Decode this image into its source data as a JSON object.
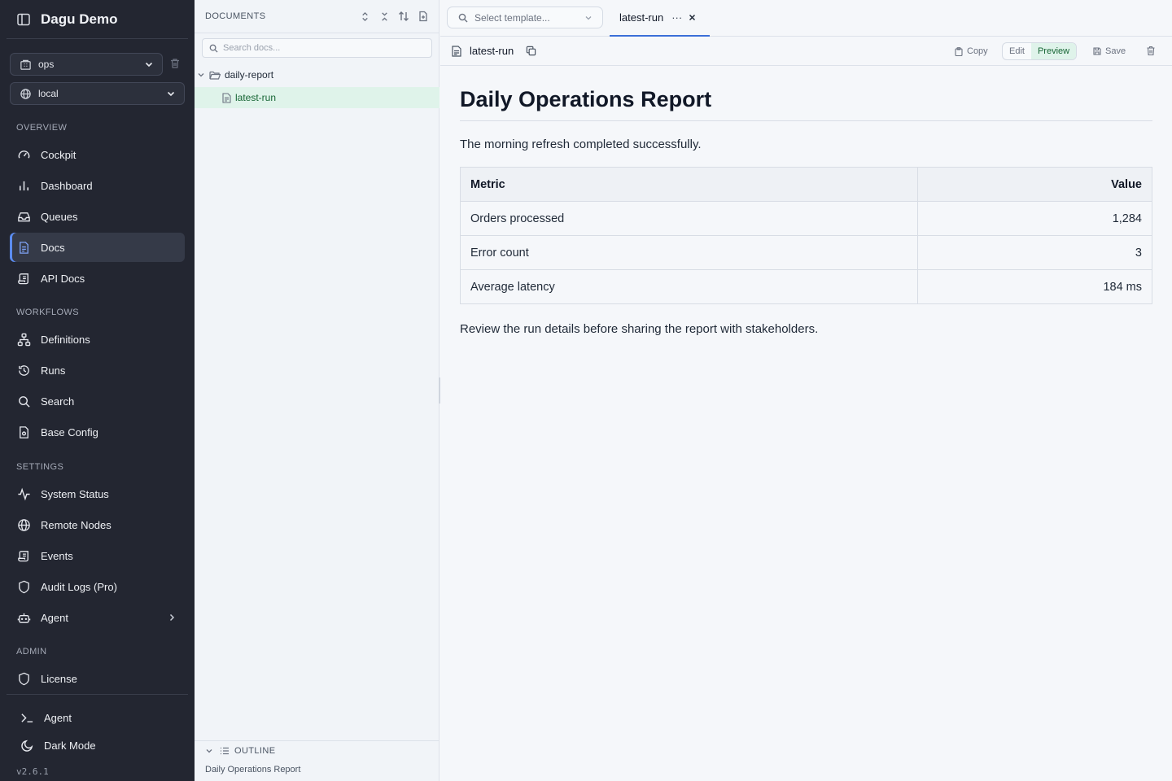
{
  "sidebar": {
    "app_title": "Dagu Demo",
    "workspace_selector": {
      "value": "ops"
    },
    "env_selector": {
      "value": "local"
    },
    "sections": {
      "overview": "OVERVIEW",
      "workflows": "WORKFLOWS",
      "settings": "SETTINGS",
      "admin": "ADMIN"
    },
    "items": {
      "cockpit": "Cockpit",
      "dashboard": "Dashboard",
      "queues": "Queues",
      "docs": "Docs",
      "api_docs": "API Docs",
      "definitions": "Definitions",
      "runs": "Runs",
      "search": "Search",
      "base_config": "Base Config",
      "system_status": "System Status",
      "remote_nodes": "Remote Nodes",
      "events": "Events",
      "audit_logs": "Audit Logs (Pro)",
      "agent": "Agent",
      "license": "License"
    },
    "footer": {
      "agent": "Agent",
      "dark_mode": "Dark Mode",
      "version": "v2.6.1"
    },
    "active_item": "Docs",
    "accent_color": "#5b8cf0"
  },
  "docs_panel": {
    "title": "DOCUMENTS",
    "search_placeholder": "Search docs...",
    "tree": {
      "folder": "daily-report",
      "file": "latest-run"
    },
    "outline": {
      "title": "OUTLINE",
      "items": [
        "Daily Operations Report"
      ]
    }
  },
  "main": {
    "template_placeholder": "Select template...",
    "tab": {
      "label": "latest-run",
      "more": "···"
    },
    "toolbar": {
      "doc_name": "latest-run",
      "copy": "Copy",
      "edit": "Edit",
      "preview": "Preview",
      "save": "Save",
      "mode": "Preview"
    },
    "document": {
      "title": "Daily Operations Report",
      "intro": "The morning refresh completed successfully.",
      "table": {
        "headers": [
          "Metric",
          "Value"
        ],
        "rows": [
          [
            "Orders processed",
            "1,284"
          ],
          [
            "Error count",
            "3"
          ],
          [
            "Average latency",
            "184 ms"
          ]
        ]
      },
      "outro": "Review the run details before sharing the report with stakeholders."
    }
  }
}
